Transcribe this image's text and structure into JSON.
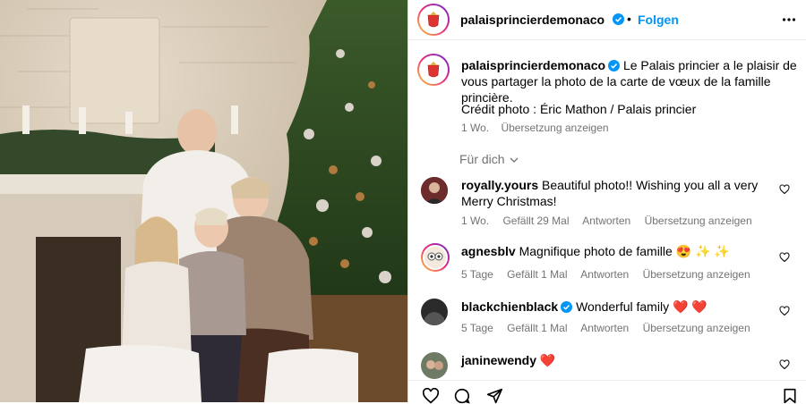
{
  "post": {
    "username": "palaisprincierdemonaco",
    "follow_label": "Folgen",
    "caption": "Le Palais princier a le plaisir de vous partager la photo de la carte de vœux de la famille princière.",
    "credit": "Crédit photo : Éric Mathon / Palais princier",
    "age": "1 Wo.",
    "translate": "Übersetzung anzeigen",
    "sort_label": "Für dich"
  },
  "comments": [
    {
      "user": "royally.yours",
      "text": "Beautiful photo!! Wishing you all a very Merry Christmas!",
      "age": "1 Wo.",
      "likes": "Gefällt 29 Mal",
      "reply": "Antworten",
      "translate": "Übersetzung anzeigen",
      "verified": false
    },
    {
      "user": "agnesblv",
      "text": "Magnifique photo de famille 😍 ✨ ✨",
      "age": "5 Tage",
      "likes": "Gefällt 1 Mal",
      "reply": "Antworten",
      "translate": "Übersetzung anzeigen",
      "verified": false
    },
    {
      "user": "blackchienblack",
      "text": "Wonderful family ❤️ ❤️",
      "age": "5 Tage",
      "likes": "Gefällt 1 Mal",
      "reply": "Antworten",
      "translate": "Übersetzung anzeigen",
      "verified": true
    },
    {
      "user": "janinewendy",
      "text": "❤️",
      "verified": false
    }
  ],
  "icons": [
    "more-icon",
    "verified-icon",
    "heart-icon",
    "comment-icon",
    "share-icon",
    "bookmark-icon",
    "chevron-down-icon"
  ],
  "colors": {
    "accent": "#0095f6",
    "muted": "#737373",
    "heart": "#ed4956"
  }
}
